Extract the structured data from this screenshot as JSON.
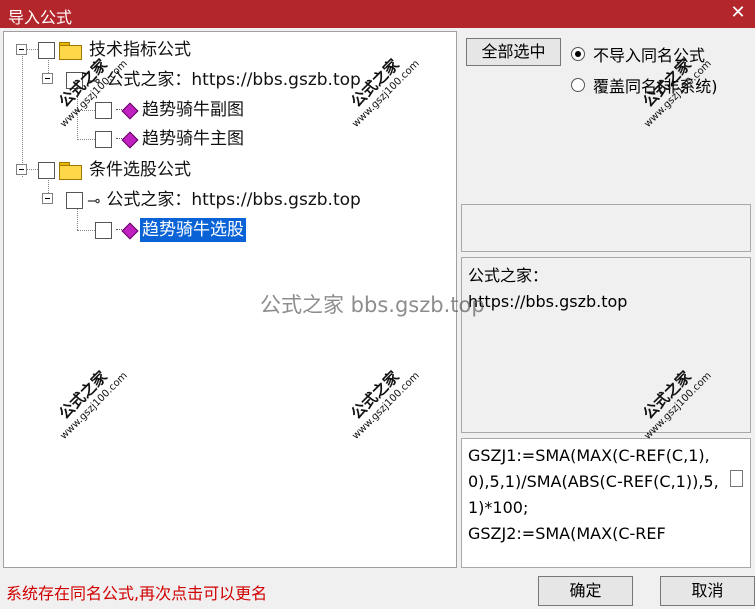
{
  "window": {
    "title": "导入公式",
    "close_glyph": "✕"
  },
  "tree": {
    "group1": {
      "label": "技术指标公式",
      "child": {
        "label": "公式之家：https://bbs.gszb.top",
        "items": [
          "趋势骑牛副图",
          "趋势骑牛主图"
        ]
      }
    },
    "group2": {
      "label": "条件选股公式",
      "child": {
        "label": "公式之家：https://bbs.gszb.top",
        "items": [
          "趋势骑牛选股"
        ]
      }
    },
    "selected_item": "趋势骑牛选股"
  },
  "right_panel": {
    "select_all_label": "全部选中",
    "options": [
      {
        "label": "不导入同名公式",
        "selected": true
      },
      {
        "label": "覆盖同名(非系统)",
        "selected": false
      }
    ]
  },
  "info_text": {
    "line1": "公式之家：",
    "line2": "https://bbs.gszb.top"
  },
  "code_text": "GSZJ1:=SMA(MAX(C-REF(C,1),0),5,1)/SMA(ABS(C-REF(C,1)),5,1)*100;\nGSZJ2:=SMA(MAX(C-REF",
  "status_text": "系统存在同名公式,再次点击可以更名",
  "buttons": {
    "ok": "确定",
    "cancel": "取消"
  },
  "watermark": {
    "center": "公式之家 bbs.gszb.top",
    "stamp_cn": "公式之家",
    "stamp_url": "www.gszj100.com"
  },
  "icons": [
    "folder-icon",
    "key-icon",
    "formula-gem-icon",
    "close-icon"
  ],
  "colors": {
    "titlebar": "#b3262b",
    "selection": "#0a63d6",
    "status_text": "#d00000",
    "gem": "#c020c0",
    "folder": "#ffd84a"
  }
}
